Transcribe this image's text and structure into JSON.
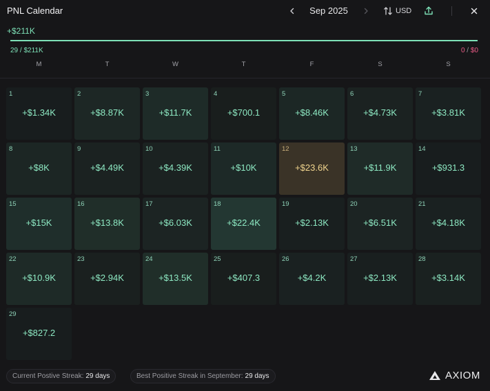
{
  "header": {
    "title": "PNL Calendar",
    "month": "Sep 2025",
    "currency": "USD"
  },
  "summary": {
    "total_pnl": "+$211K",
    "positive_days": "29",
    "positive_total": "$211K",
    "negative_days": "0",
    "negative_total": "$0",
    "positive_fraction": 1.0
  },
  "weekdays": [
    "M",
    "T",
    "W",
    "T",
    "F",
    "S",
    "S"
  ],
  "colors": {
    "positive": "#7ee2b8",
    "negative": "#ec5b87",
    "best_day": "#f1d58e"
  },
  "days": [
    {
      "day": "1",
      "pnl": "+$1.34K",
      "value": 1340
    },
    {
      "day": "2",
      "pnl": "+$8.87K",
      "value": 8870
    },
    {
      "day": "3",
      "pnl": "+$11.7K",
      "value": 11700
    },
    {
      "day": "4",
      "pnl": "+$700.1",
      "value": 700.1
    },
    {
      "day": "5",
      "pnl": "+$8.46K",
      "value": 8460
    },
    {
      "day": "6",
      "pnl": "+$4.73K",
      "value": 4730
    },
    {
      "day": "7",
      "pnl": "+$3.81K",
      "value": 3810
    },
    {
      "day": "8",
      "pnl": "+$8K",
      "value": 8000
    },
    {
      "day": "9",
      "pnl": "+$4.49K",
      "value": 4490
    },
    {
      "day": "10",
      "pnl": "+$4.39K",
      "value": 4390
    },
    {
      "day": "11",
      "pnl": "+$10K",
      "value": 10000
    },
    {
      "day": "12",
      "pnl": "+$23.6K",
      "value": 23600,
      "best": true
    },
    {
      "day": "13",
      "pnl": "+$11.9K",
      "value": 11900
    },
    {
      "day": "14",
      "pnl": "+$931.3",
      "value": 931.3
    },
    {
      "day": "15",
      "pnl": "+$15K",
      "value": 15000
    },
    {
      "day": "16",
      "pnl": "+$13.8K",
      "value": 13800
    },
    {
      "day": "17",
      "pnl": "+$6.03K",
      "value": 6030
    },
    {
      "day": "18",
      "pnl": "+$22.4K",
      "value": 22400
    },
    {
      "day": "19",
      "pnl": "+$2.13K",
      "value": 2130
    },
    {
      "day": "20",
      "pnl": "+$6.51K",
      "value": 6510
    },
    {
      "day": "21",
      "pnl": "+$4.18K",
      "value": 4180
    },
    {
      "day": "22",
      "pnl": "+$10.9K",
      "value": 10900
    },
    {
      "day": "23",
      "pnl": "+$2.94K",
      "value": 2940
    },
    {
      "day": "24",
      "pnl": "+$13.5K",
      "value": 13500
    },
    {
      "day": "25",
      "pnl": "+$407.3",
      "value": 407.3
    },
    {
      "day": "26",
      "pnl": "+$4.2K",
      "value": 4200
    },
    {
      "day": "27",
      "pnl": "+$2.13K",
      "value": 2130
    },
    {
      "day": "28",
      "pnl": "+$3.14K",
      "value": 3140
    },
    {
      "day": "29",
      "pnl": "+$827.2",
      "value": 827.2
    }
  ],
  "footer": {
    "current_streak_label": "Current Postive Streak:",
    "current_streak_value": "29 days",
    "best_streak_label": "Best Positive Streak in September:",
    "best_streak_value": "29 days",
    "brand": "AXIOM"
  },
  "icons": {
    "prev": "chevron-left-icon",
    "next": "chevron-right-icon",
    "sort": "sort-arrows-icon",
    "share": "share-upload-icon",
    "close": "close-icon",
    "logo": "axiom-logo-icon"
  }
}
